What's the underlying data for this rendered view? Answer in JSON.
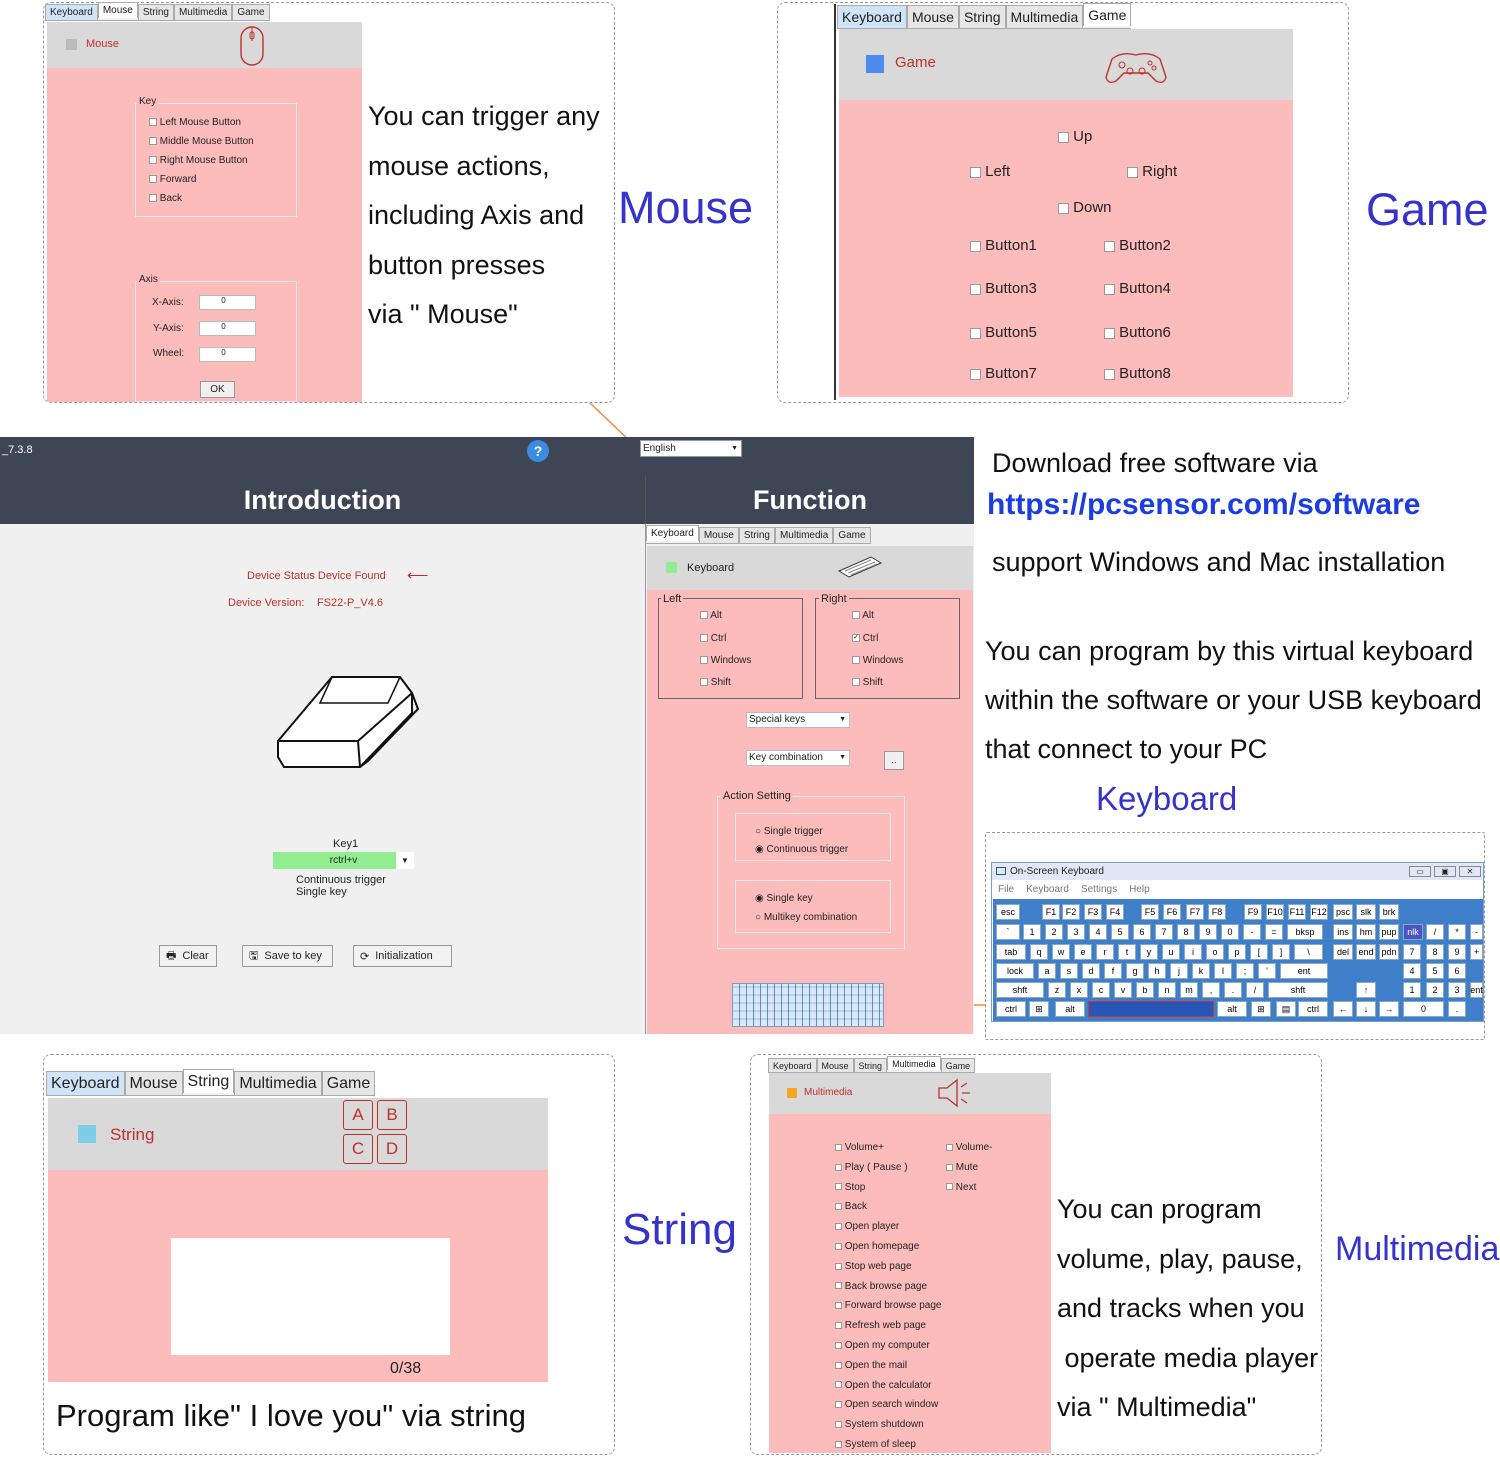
{
  "tabs": [
    "Keyboard",
    "Mouse",
    "String",
    "Multimedia",
    "Game"
  ],
  "mouse": {
    "title": "Mouse",
    "key_label": "Key",
    "keys": [
      "Left Mouse Button",
      "Middle Mouse Button",
      "Right Mouse Button",
      "Forward",
      "Back"
    ],
    "axis_label": "Axis",
    "axes": [
      {
        "label": "X-Axis:",
        "value": "0"
      },
      {
        "label": "Y-Axis:",
        "value": "0"
      },
      {
        "label": "Wheel:",
        "value": "0"
      }
    ],
    "ok": "OK",
    "desc": [
      "You can trigger any",
      "mouse actions,",
      "including Axis and",
      "button presses",
      "via \" Mouse\""
    ],
    "big": "Mouse"
  },
  "game": {
    "title": "Game",
    "up": "Up",
    "left": "Left",
    "right": "Right",
    "down": "Down",
    "buttons": [
      "Button1",
      "Button2",
      "Button3",
      "Button4",
      "Button5",
      "Button6",
      "Button7",
      "Button8"
    ],
    "big": "Game"
  },
  "app": {
    "version": "_7.3.8",
    "language": "English",
    "intro": "Introduction",
    "function": "Function",
    "status": "Device Status Device Found",
    "device_version_label": "Device Version:",
    "device_version": "FS22-P_V4.6",
    "key1": "Key1",
    "key1_value": "rctrl+v",
    "trigger1": "Continuous trigger",
    "trigger2": "Single key",
    "clear": "Clear",
    "save": "Save to key",
    "init": "Initialization"
  },
  "kbpanel": {
    "title": "Keyboard",
    "left": "Left",
    "right": "Right",
    "mods": [
      "Alt",
      "Ctrl",
      "Windows",
      "Shift"
    ],
    "special": "Special keys",
    "combo": "Key combination",
    "dots": "..",
    "action": "Action Setting",
    "single_trigger": "Single trigger",
    "cont_trigger": "Continuous trigger",
    "single_key": "Single key",
    "multikey": "Multikey  combination"
  },
  "download": {
    "line1": "Download free software via",
    "url": "https://pcsensor.com/software",
    "line2": "support Windows and Mac installation",
    "p1": "You can program by this virtual keyboard",
    "p2": "within the software or your USB keyboard",
    "p3": "that connect to your PC",
    "big": "Keyboard"
  },
  "osk": {
    "title": "On-Screen Keyboard",
    "menu": [
      "File",
      "Keyboard",
      "Settings",
      "Help"
    ],
    "rows": [
      [
        "esc",
        "F1",
        "F2",
        "F3",
        "F4",
        "F5",
        "F6",
        "F7",
        "F8",
        "F9",
        "F10",
        "F11",
        "F12",
        "psc",
        "slk",
        "brk"
      ],
      [
        "`",
        "1",
        "2",
        "3",
        "4",
        "5",
        "6",
        "7",
        "8",
        "9",
        "0",
        "-",
        "=",
        "bksp",
        "ins",
        "hm",
        "pup",
        "nlk",
        "/",
        "*",
        "-"
      ],
      [
        "tab",
        "q",
        "w",
        "e",
        "r",
        "t",
        "y",
        "u",
        "i",
        "o",
        "p",
        "[",
        "]",
        "\\",
        "del",
        "end",
        "pdn",
        "7",
        "8",
        "9",
        "+"
      ],
      [
        "lock",
        "a",
        "s",
        "d",
        "f",
        "g",
        "h",
        "j",
        "k",
        "l",
        ";",
        "'",
        "ent",
        "4",
        "5",
        "6"
      ],
      [
        "shft",
        "z",
        "x",
        "c",
        "v",
        "b",
        "n",
        "m",
        ",",
        ".",
        "/",
        "shft",
        "↑",
        "1",
        "2",
        "3",
        "ent"
      ],
      [
        "ctrl",
        "alt",
        "alt",
        "ctrl",
        "←",
        "↓",
        "→",
        "0",
        "."
      ]
    ]
  },
  "string": {
    "title": "String",
    "letters": [
      "A",
      "B",
      "C",
      "D"
    ],
    "counter": "0/38",
    "caption": "Program like\" I love you\" via string",
    "big": "String"
  },
  "multimedia": {
    "title": "Multimedia",
    "col1": [
      "Volume+",
      "Play ( Pause )",
      "Stop",
      "Back",
      "Open player",
      "Open homepage",
      "Stop web page",
      "Back browse page",
      "Forward browse page",
      "Refresh web page",
      "Open my computer",
      "Open the mail",
      "Open the calculator",
      "Open search window",
      "System shutdown",
      "System of sleep"
    ],
    "col2": [
      "Volume-",
      "Mute",
      "Next"
    ],
    "desc": [
      "You can program",
      "volume, play, pause,",
      "and tracks when you",
      " operate media player",
      "via \" Multimedia\""
    ],
    "big": "Multimedia"
  },
  "colors": {
    "pink": "#fdbcbc",
    "accent": "#3533c9",
    "header": "#3e4555",
    "green": "#90ee90"
  }
}
